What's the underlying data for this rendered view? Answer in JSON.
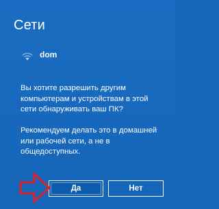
{
  "dialog": {
    "title": "Сети",
    "network_name": "dom",
    "message_1": "Вы хотите разрешить другим компьютерам и устройствам в этой сети обнаруживать ваш ПК?",
    "message_2": "Рекомендуем делать это в домашней или рабочей сети, а не в общедоступных.",
    "yes_label": "Да",
    "no_label": "Нет"
  },
  "icons": {
    "network": "wifi-icon",
    "annotation": "arrow-icon"
  },
  "colors": {
    "background": "#1565b8",
    "text": "#ffffff",
    "annotation_arrow": "#e0202a"
  }
}
